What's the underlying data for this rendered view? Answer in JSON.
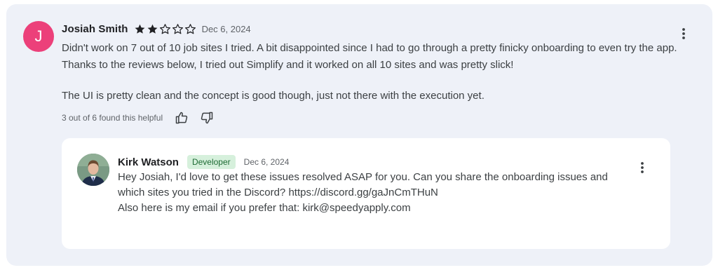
{
  "review": {
    "avatar_letter": "J",
    "avatar_color": "#ec407a",
    "author": "Josiah Smith",
    "rating": 2,
    "max_rating": 5,
    "date": "Dec 6, 2024",
    "paragraph_1": "Didn't work on 7 out of 10 job sites I tried. A bit disappointed since I had to go through a pretty finicky onboarding to even try the app. Thanks to the reviews below, I tried out Simplify and it worked on all 10 sites and was pretty slick!",
    "paragraph_2": "The UI is pretty clean and the concept is good though, just not there with the execution yet.",
    "helpful_text": "3 out of 6 found this helpful",
    "more_icon": "more-vert-icon"
  },
  "reply": {
    "author": "Kirk Watson",
    "badge": "Developer",
    "badge_color": "#d6f0dc",
    "date": "Dec 6, 2024",
    "line_1": "Hey Josiah, I'd love to get these issues resolved ASAP for you. Can you share the onboarding issues and which sites you tried in the Discord?  https://discord.gg/gaJnCmTHuN",
    "line_2": "Also here is my email if you prefer that: kirk@speedyapply.com",
    "more_icon": "more-vert-icon"
  },
  "icons": {
    "thumb_up": "thumb-up-icon",
    "thumb_down": "thumb-down-icon",
    "star_filled": "star-filled-icon",
    "star_empty": "star-outline-icon"
  }
}
